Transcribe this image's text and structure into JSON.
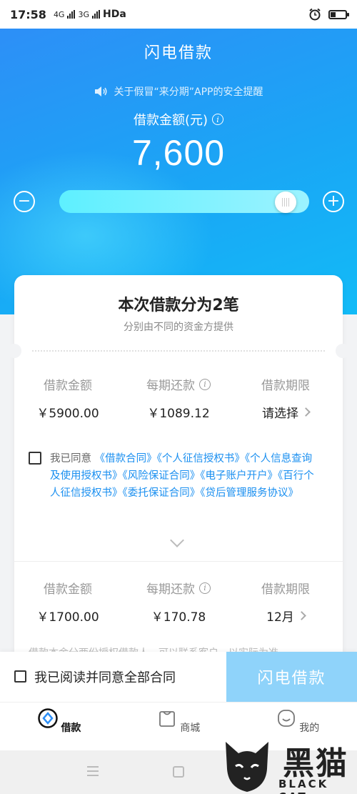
{
  "status_bar": {
    "time": "17:58",
    "network1": "4G",
    "network2": "3G",
    "hd": "HDa"
  },
  "header": {
    "title": "闪电借款"
  },
  "notice": {
    "text": "关于假冒“来分期”APP的安全提醒",
    "icon": "speaker-icon"
  },
  "loan": {
    "amount_label": "借款金额(元)",
    "amount": "7,600",
    "slider_fraction": 0.95,
    "colors": {
      "hero_top": "#2d8ff7",
      "hero_bottom": "#12bbf7",
      "track": "#5ef0ff",
      "link": "#1a8ff0",
      "button": "#8fd3fa"
    }
  },
  "card": {
    "title": "本次借款分为2笔",
    "subtitle": "分别由不同的资金方提供",
    "loans": [
      {
        "amount_header": "借款金额",
        "payment_header": "每期还款",
        "term_header": "借款期限",
        "amount": "￥5900.00",
        "payment": "￥1089.12",
        "term": "请选择"
      },
      {
        "amount_header": "借款金额",
        "payment_header": "每期还款",
        "term_header": "借款期限",
        "amount": "￥1700.00",
        "payment": "￥170.78",
        "term": "12月"
      }
    ],
    "agreement": {
      "prefix": "我已同意",
      "links": [
        "《借款合同》",
        "《个人征信授权书》",
        "《个人信息查询及使用授权书》",
        "《风险保证合同》",
        "《电子账户开户》",
        "《百行个人征信授权书》",
        "《委托保证合同》",
        "《贷后管理服务协议》"
      ]
    },
    "faded_text": "借款本金分两份授权借款人，可以联系客户，以实际为准"
  },
  "action_bar": {
    "agree_all": "我已阅读并同意全部合同",
    "submit": "闪电借款"
  },
  "tabs": [
    {
      "label": "借款",
      "icon": "loan-icon",
      "active": true
    },
    {
      "label": "商城",
      "icon": "shop-bag-icon",
      "active": false
    },
    {
      "label": "我的",
      "icon": "profile-face-icon",
      "active": false
    }
  ],
  "watermark": {
    "big": "黑猫",
    "small": "BLACK CAT"
  }
}
